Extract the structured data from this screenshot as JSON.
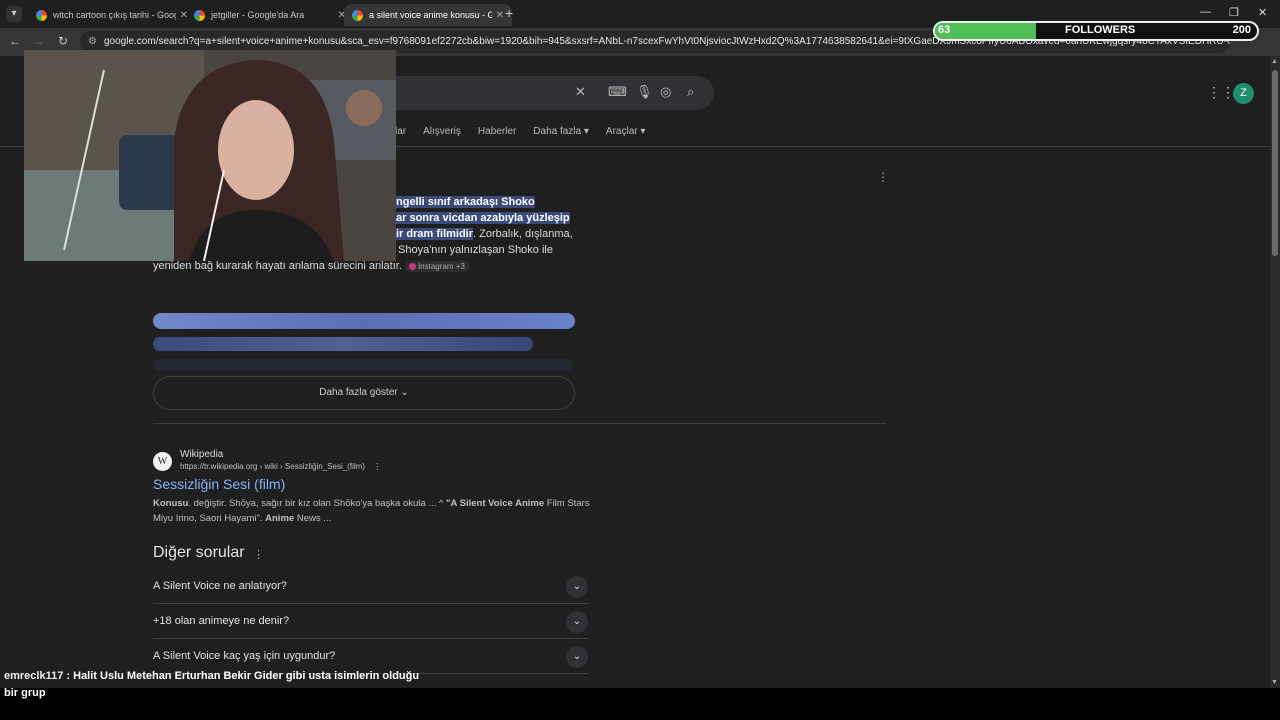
{
  "browser": {
    "tabs": [
      {
        "label": "witch cartoon çıkış tarihi - Goog",
        "active": false
      },
      {
        "label": "jetgiller - Google'da Ara",
        "active": false
      },
      {
        "label": "a silent voice anime konusu - G",
        "active": true
      }
    ],
    "new_tab_symbol": "+",
    "url": "google.com/search?q=a+silent+voice+anime+konusu&sca_esv=f9768091ef2272cb&biw=1920&bih=945&sxsrf=ANbL-n7scexFwYhVt0NjsviocJtWzHxd2Q%3A1774638582641&ei=9tXGaeDXJmSxc8PIfyU6ABOxaved=0ahUKEwjgqsry48CTAxVSIEDHRU-6a0Q4dUDCb..."
  },
  "stream_overlay": {
    "followers_label": "FOLLOWERS",
    "current": "63",
    "goal": "200",
    "progress_fraction": 0.315,
    "bar_color": "#4fbf5a"
  },
  "search": {
    "filters": [
      "lar",
      "Alışveriş",
      "Haberler",
      "Daha fazla",
      "Araçlar"
    ],
    "account_initial": "Z",
    "account_color": "#1e8e6e"
  },
  "overview": {
    "line1_hl": "ngelli sınıf arkadaşı Shoko",
    "line2_hl": "ar sonra vicdan azabıyla yüzleşip",
    "line3_hl": "ir dram filmidir",
    "line3_rest": ". Zorbalık, dışlanma,",
    "line4": "Shoya'nın yalnızlaşan Shoko ile",
    "line5": "yeniden bağ kurarak hayatı anlama sürecini anlatır.",
    "source_chip": "Instagram +3",
    "show_more": "Daha fazla göster"
  },
  "result": {
    "source_name": "Wikipedia",
    "url": "https://tr.wikipedia.org › wiki › Sessizliğin_Sesi_(film)",
    "logo_letter": "W",
    "title": "Sessizliğin Sesi (film)",
    "desc_bold1": "Konusu",
    "desc_text1": ". değiştir. Shōya, sağır bir kız olan Shōko'ya başka okula ... ^ ",
    "desc_bold2": "\"A Silent Voice Anime",
    "desc_text2": " Film Stars Miyu Irino, Saori Hayami\". ",
    "desc_bold3": "Anime",
    "desc_text3": " News ..."
  },
  "paa": {
    "title": "Diğer sorular",
    "questions": [
      "A Silent Voice ne anlatıyor?",
      "+18 olan animeye ne denir?",
      "A Silent Voice kaç yaş için uygundur?"
    ]
  },
  "chat": {
    "user": "emreclk117",
    "message": ": Halit Uslu Metehan Erturhan Bekir Gider gibi usta isimlerin olduğu bir grup"
  }
}
